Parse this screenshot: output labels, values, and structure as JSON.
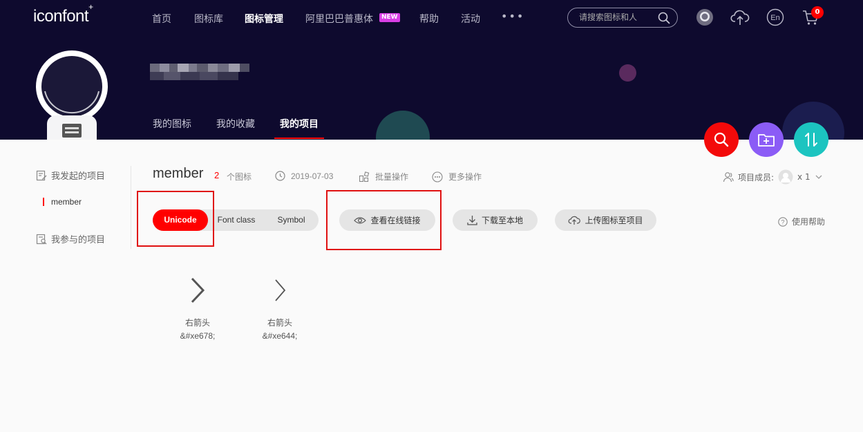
{
  "brand": {
    "logo_text": "iconfont",
    "logo_mark": "+"
  },
  "nav": {
    "items": [
      "首页",
      "图标库",
      "图标管理",
      "阿里巴巴普惠体",
      "帮助",
      "活动"
    ],
    "active_index": 2,
    "new_badge": "NEW",
    "more": "•••"
  },
  "search": {
    "placeholder": "请搜索图标和人"
  },
  "cart": {
    "count": "0"
  },
  "lang_label": "En",
  "profile_tabs": [
    "我的图标",
    "我的收藏",
    "我的项目"
  ],
  "profile_tab_active": 2,
  "sidebar": {
    "created_label": "我发起的项目",
    "project_item": "member",
    "joined_label": "我参与的项目"
  },
  "project": {
    "name": "member",
    "icon_count": "2",
    "icon_count_suffix": "个图标",
    "date": "2019-07-03",
    "batch_label": "批量操作",
    "more_label": "更多操作",
    "members_label": "项目成员:",
    "members_count": "x 1"
  },
  "format_tabs": [
    "Unicode",
    "Font class",
    "Symbol"
  ],
  "format_active": 0,
  "actions": {
    "view_online": "查看在线链接",
    "download": "下载至本地",
    "upload": "上传图标至项目",
    "help": "使用帮助"
  },
  "icons": [
    {
      "name": "右箭头",
      "code": "&#xe678;",
      "glyph": "chevron-right"
    },
    {
      "name": "右箭头",
      "code": "&#xe644;",
      "glyph": "chevron-right"
    }
  ],
  "colors": {
    "hero_bg": "#0e0a2e",
    "accent_red": "#ff0000",
    "fab_purple": "#8b5cf6",
    "fab_teal": "#1cc4c0"
  }
}
